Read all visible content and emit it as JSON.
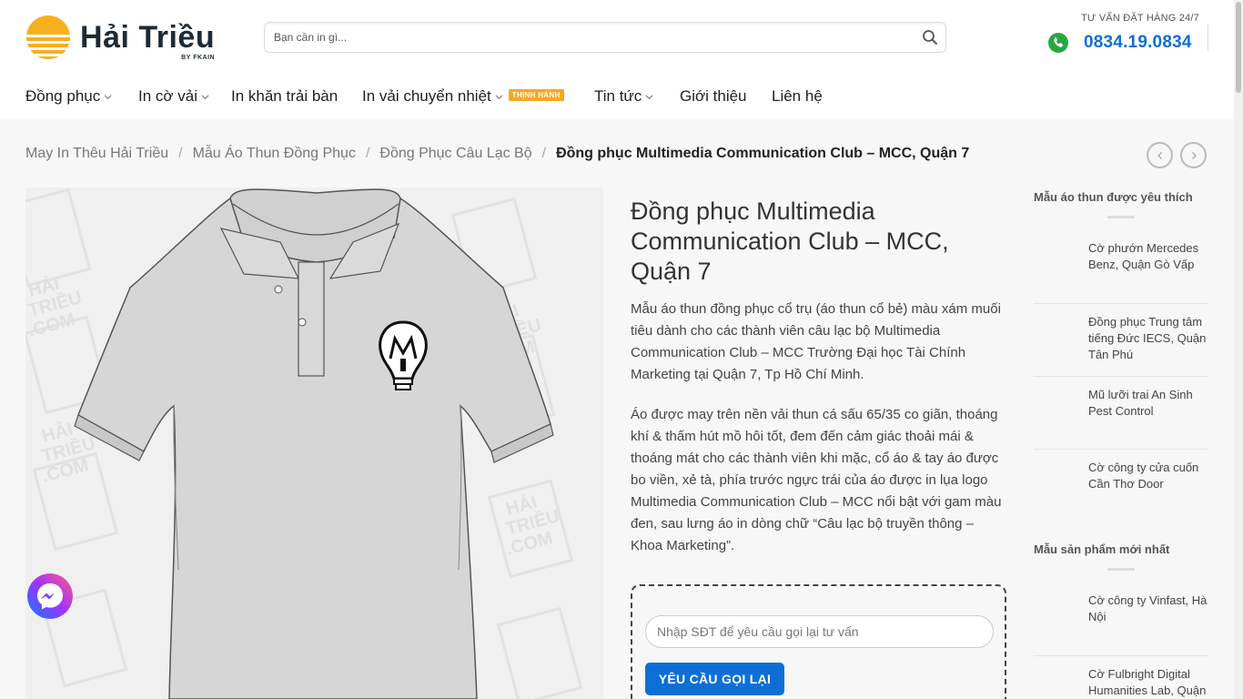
{
  "header": {
    "logo": {
      "name": "Hải Triều",
      "sub": "BY FKAIN"
    },
    "search": {
      "placeholder": "Bạn cần in gì..."
    },
    "hotline": {
      "label": "TƯ VẤN ĐẶT HÀNG 24/7",
      "number": "0834.19.0834"
    }
  },
  "nav": {
    "items": [
      {
        "label": "Đồng phục",
        "has_dropdown": true
      },
      {
        "label": "In cờ vải",
        "has_dropdown": true
      },
      {
        "label": "In khăn trải bàn",
        "has_dropdown": false
      },
      {
        "label": "In vải chuyển nhiệt",
        "has_dropdown": true,
        "badge": "THỊNH HÀNH"
      },
      {
        "label": "Tin tức",
        "has_dropdown": true
      },
      {
        "label": "Giới thiệu",
        "has_dropdown": false
      },
      {
        "label": "Liên hệ",
        "has_dropdown": false
      }
    ]
  },
  "breadcrumb": {
    "items": [
      "May In Thêu Hải Triều",
      "Mẫu Áo Thun Đồng Phục",
      "Đồng Phục Câu Lạc Bộ"
    ],
    "separator": "/",
    "current": "Đồng phục Multimedia Communication Club – MCC, Quận 7"
  },
  "product": {
    "title": "Đồng phục Multimedia Communication Club – MCC, Quận 7",
    "description": [
      "Mẫu áo thun đồng phục cổ trụ (áo thun cổ bẻ) màu xám muối tiêu dành cho các thành viên câu lạc bộ Multimedia Communication Club – MCC Trường Đại học Tài Chính Marketing tại Quận 7, Tp Hồ Chí Minh.",
      "Áo được may trên nền vải thun cá sấu 65/35 co giãn, thoáng khí & thấm hút mồ hôi tốt, đem đến cảm giác thoải mái & thoáng mát cho các thành viên khi mặc, cổ áo & tay áo được bo viền, xẻ tà, phía trước ngực trái của áo được in lụa logo Multimedia Communication Club – MCC nổi bật với gam màu đen, sau lưng áo in dòng chữ “Câu lạc bộ truyền thông – Khoa Marketing”."
    ],
    "watermark": [
      "HẢI",
      "TRIỀU",
      ".COM"
    ]
  },
  "callback": {
    "placeholder": "Nhập SĐT để yêu cầu gọi lại tư vấn",
    "button": "YÊU CẦU GỌI LẠI"
  },
  "sidebar": {
    "favorite_heading": "Mẫu áo thun được yêu thích",
    "favorites": [
      "Cờ phướn Mercedes Benz, Quận Gò Vấp",
      "Đồng phục Trung tâm tiếng Đức IECS, Quận Tân Phú",
      "Mũ lưỡi trai An Sinh Pest Control",
      "Cờ công ty cửa cuốn Cần Thơ Door"
    ],
    "newest_heading": "Mẫu sản phẩm mới nhất",
    "newest": [
      "Cờ công ty Vinfast, Hà Nội",
      "Cờ Fulbright Digital Humanities Lab, Quận"
    ]
  },
  "colors": {
    "accent": "#0d6fd6",
    "badge": "#f6a821",
    "phone": "#27a744",
    "logo_sun": "#f6b01e"
  }
}
